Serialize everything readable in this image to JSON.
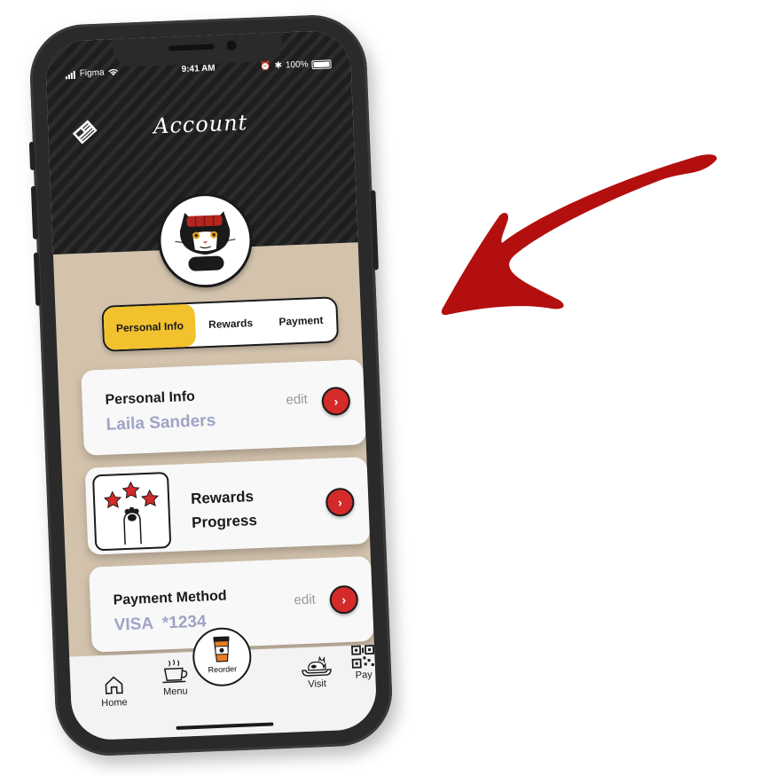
{
  "status_bar": {
    "carrier": "Figma",
    "time": "9:41 AM",
    "battery": "100%"
  },
  "header": {
    "title": "Account",
    "news_icon": "newspaper-icon"
  },
  "tabs": [
    {
      "label": "Personal Info",
      "active": true
    },
    {
      "label": "Rewards",
      "active": false
    },
    {
      "label": "Payment",
      "active": false
    }
  ],
  "cards": {
    "personal": {
      "title": "Personal Info",
      "value": "Laila Sanders",
      "edit_label": "edit"
    },
    "rewards": {
      "title_line1": "Rewards",
      "title_line2": "Progress"
    },
    "payment": {
      "title": "Payment Method",
      "value": "VISA  *1234",
      "edit_label": "edit"
    }
  },
  "bottom_nav": {
    "home": "Home",
    "menu": "Menu",
    "reorder": "Reorder",
    "visit": "Visit",
    "pay": "Pay"
  },
  "colors": {
    "accent": "#f2c12e",
    "danger": "#d42a2a",
    "arrow": "#b30f0f",
    "beige": "#d3c3ad",
    "value_text": "#9fa3c4"
  }
}
